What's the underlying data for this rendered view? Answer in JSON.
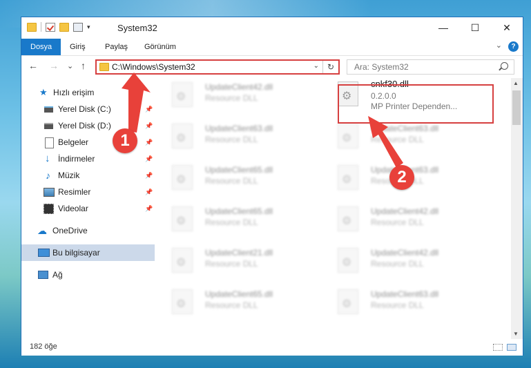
{
  "window": {
    "title": "System32",
    "minimize": "—",
    "maximize": "☐",
    "close": "✕"
  },
  "quick_access_toolbar": {
    "dropdown": "▾"
  },
  "ribbon": {
    "tabs": [
      "Dosya",
      "Giriş",
      "Paylaş",
      "Görünüm"
    ],
    "collapse": "⌄",
    "help": "?"
  },
  "nav": {
    "back": "←",
    "forward": "→",
    "history": "⌄",
    "up": "↑"
  },
  "address": {
    "path": "C:\\Windows\\System32",
    "dropdown": "⌄",
    "refresh": "↻"
  },
  "search": {
    "placeholder": "Ara: System32"
  },
  "sidebar": {
    "quick_access": "Hızlı erişim",
    "items": [
      {
        "label": "Yerel Disk (C:)",
        "icon": "drive-icon",
        "pin": "📌"
      },
      {
        "label": "Yerel Disk (D:)",
        "icon": "drive-icon",
        "pin": "📌"
      },
      {
        "label": "Belgeler",
        "icon": "document-icon",
        "pin": "📌"
      },
      {
        "label": "İndirmeler",
        "icon": "download-icon",
        "pin": "📌"
      },
      {
        "label": "Müzik",
        "icon": "music-icon",
        "pin": "📌"
      },
      {
        "label": "Resimler",
        "icon": "pictures-icon",
        "pin": "📌"
      },
      {
        "label": "Videolar",
        "icon": "video-icon",
        "pin": "📌"
      }
    ],
    "onedrive": "OneDrive",
    "this_pc": "Bu bilgisayar",
    "network": "Ağ"
  },
  "files": {
    "highlighted": {
      "name": "cnkf30.dll",
      "version": "0.2.0.0",
      "description": "MP Printer Dependen..."
    },
    "left_column": [
      {
        "name": "UpdateClient42.dll",
        "type": "Resource DLL"
      },
      {
        "name": "UpdateClient63.dll",
        "type": "Resource DLL"
      },
      {
        "name": "UpdateClient65.dll",
        "type": "Resource DLL"
      },
      {
        "name": "UpdateClient65.dll",
        "type": "Resource DLL"
      },
      {
        "name": "UpdateClient21.dll",
        "type": "Resource DLL"
      },
      {
        "name": "UpdateClient65.dll",
        "type": "Resource DLL"
      }
    ],
    "right_column": [
      {
        "name": "UpdateClient63.dll",
        "type": "Resource DLL"
      },
      {
        "name": "UpdateClient63.dll",
        "type": "Resource DLL"
      },
      {
        "name": "UpdateClient42.dll",
        "type": "Resource DLL"
      },
      {
        "name": "UpdateClient42.dll",
        "type": "Resource DLL"
      },
      {
        "name": "UpdateClient63.dll",
        "type": "Resource DLL"
      }
    ]
  },
  "status": {
    "item_count": "182 öğe"
  },
  "callouts": [
    "1",
    "2"
  ],
  "colors": {
    "accent": "#1979ca",
    "highlight": "#d63f3f",
    "callout": "#e8413a",
    "selection": "#ccd9ea"
  }
}
